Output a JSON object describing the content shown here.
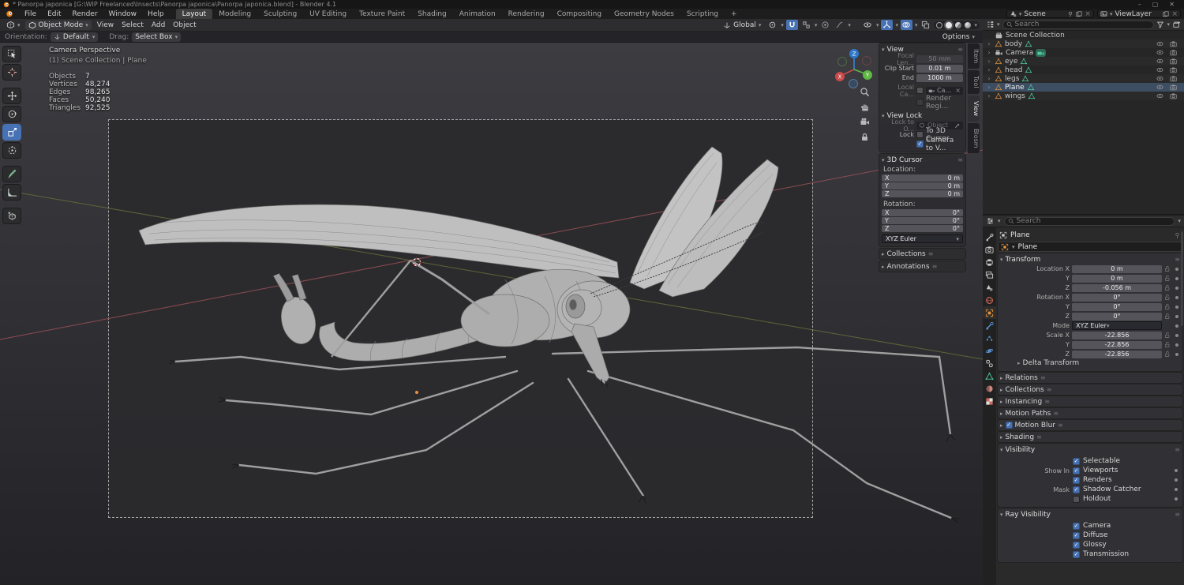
{
  "titlebar": {
    "title": "* Panorpa japonica [G:\\WIP Freelanced\\Insects\\Panorpa japonica\\Panorpa japonica.blend] - Blender 4.1",
    "minimize": "–",
    "maximize": "▢",
    "close": "✕"
  },
  "topbar": {
    "menus": [
      "File",
      "Edit",
      "Render",
      "Window",
      "Help"
    ],
    "workspaces": [
      "Layout",
      "Modeling",
      "Sculpting",
      "UV Editing",
      "Texture Paint",
      "Shading",
      "Animation",
      "Rendering",
      "Compositing",
      "Geometry Nodes",
      "Scripting"
    ],
    "active_workspace": "Layout",
    "new_workspace_label": "+",
    "scene_selector": {
      "value": "Scene"
    },
    "viewlayer_selector": {
      "value": "ViewLayer"
    }
  },
  "viewport_header": {
    "mode": "Object Mode",
    "menus": [
      "View",
      "Select",
      "Add",
      "Object"
    ],
    "orientation": "Global"
  },
  "tool_settings": {
    "orientation_label": "Orientation:",
    "orientation_value": "Default",
    "drag_label": "Drag:",
    "drag_value": "Select Box",
    "options_label": "Options"
  },
  "toolbar": {
    "tools": [
      "tweak-select",
      "cursor",
      "move",
      "rotate",
      "scale",
      "transform",
      "annotate",
      "measure",
      "add-cube"
    ],
    "active_tool": "scale"
  },
  "viewport_overlay": {
    "view_label": "Camera Perspective",
    "context_label": "(1) Scene Collection | Plane",
    "stats": [
      {
        "label": "Objects",
        "value": "7"
      },
      {
        "label": "Vertices",
        "value": "48,274"
      },
      {
        "label": "Edges",
        "value": "98,265"
      },
      {
        "label": "Faces",
        "value": "50,240"
      },
      {
        "label": "Triangles",
        "value": "92,525"
      }
    ],
    "gizmo_axes": {
      "x": "X",
      "y": "Y",
      "z": "Z"
    }
  },
  "sidebar": {
    "tabs": [
      "Item",
      "Tool",
      "View",
      "Blosm"
    ],
    "active_tab": "View",
    "view_panel": {
      "title": "View",
      "focal_label": "Focal Len...",
      "focal_value": "50 mm",
      "clip_start_label": "Clip Start",
      "clip_start_value": "0.01 m",
      "clip_end_label": "End",
      "clip_end_value": "1000 m",
      "local_camera_label": "Local Ca...",
      "local_camera_value": "Ca...",
      "render_region_label": "Render Regi..."
    },
    "view_lock_panel": {
      "title": "View Lock",
      "lock_object_label": "Lock to O...",
      "lock_object_placeholder": "Object",
      "lock_label": "Lock",
      "to_3d_cursor_label": "To 3D Cursor",
      "camera_to_view_label": "Camera to V..."
    },
    "cursor_panel": {
      "title": "3D Cursor",
      "location_label": "Location:",
      "location": [
        {
          "axis": "X",
          "value": "0 m"
        },
        {
          "axis": "Y",
          "value": "0 m"
        },
        {
          "axis": "Z",
          "value": "0 m"
        }
      ],
      "rotation_label": "Rotation:",
      "rotation": [
        {
          "axis": "X",
          "value": "0°"
        },
        {
          "axis": "Y",
          "value": "0°"
        },
        {
          "axis": "Z",
          "value": "0°"
        }
      ],
      "rotation_mode": "XYZ Euler"
    },
    "collapsed_panels": [
      "Collections",
      "Annotations"
    ]
  },
  "outliner": {
    "search_placeholder": "Search",
    "root": "Scene Collection",
    "items": [
      {
        "name": "body",
        "type": "mesh",
        "selected": false
      },
      {
        "name": "Camera",
        "type": "camera",
        "selected": false
      },
      {
        "name": "eye",
        "type": "mesh",
        "selected": false
      },
      {
        "name": "head",
        "type": "mesh",
        "selected": false
      },
      {
        "name": "legs",
        "type": "mesh",
        "selected": false
      },
      {
        "name": "Plane",
        "type": "mesh",
        "selected": true
      },
      {
        "name": "wings",
        "type": "mesh",
        "selected": false
      }
    ]
  },
  "properties": {
    "search_placeholder": "Search",
    "tabs": [
      "tool",
      "render",
      "output",
      "view-layer",
      "scene",
      "world",
      "object",
      "modifiers",
      "particles",
      "physics",
      "constraints",
      "data",
      "material",
      "texture"
    ],
    "active_tab": "object",
    "breadcrumb": "Plane",
    "name_field": "Plane",
    "transform": {
      "title": "Transform",
      "rows": [
        {
          "label": "Location X",
          "value": "0 m",
          "widget": "field"
        },
        {
          "label": "Y",
          "value": "0 m",
          "widget": "field"
        },
        {
          "label": "Z",
          "value": "-0.056 m",
          "widget": "field"
        },
        {
          "label": "Rotation X",
          "value": "0°",
          "widget": "field"
        },
        {
          "label": "Y",
          "value": "0°",
          "widget": "field"
        },
        {
          "label": "Z",
          "value": "0°",
          "widget": "field"
        },
        {
          "label": "Mode",
          "value": "XYZ Euler",
          "widget": "dropdown"
        },
        {
          "label": "Scale X",
          "value": "-22.856",
          "widget": "field"
        },
        {
          "label": "Y",
          "value": "-22.856",
          "widget": "field"
        },
        {
          "label": "Z",
          "value": "-22.856",
          "widget": "field"
        }
      ],
      "sub_collapsed": "Delta Transform"
    },
    "collapsed_panels": [
      {
        "label": "Relations",
        "checkbox": false,
        "checked": false
      },
      {
        "label": "Collections",
        "checkbox": false,
        "checked": false
      },
      {
        "label": "Instancing",
        "checkbox": false,
        "checked": false
      },
      {
        "label": "Motion Paths",
        "checkbox": false,
        "checked": false
      },
      {
        "label": "Motion Blur",
        "checkbox": true,
        "checked": true
      },
      {
        "label": "Shading",
        "checkbox": false,
        "checked": false
      }
    ],
    "visibility": {
      "title": "Visibility",
      "rows": [
        {
          "prefix": "",
          "label": "Selectable",
          "checked": true,
          "dot": false
        },
        {
          "prefix": "Show In",
          "label": "Viewports",
          "checked": true,
          "dot": true
        },
        {
          "prefix": "",
          "label": "Renders",
          "checked": true,
          "dot": true
        },
        {
          "prefix": "Mask",
          "label": "Shadow Catcher",
          "checked": true,
          "dot": true
        },
        {
          "prefix": "",
          "label": "Holdout",
          "checked": false,
          "dot": true
        }
      ]
    },
    "ray_visibility": {
      "title": "Ray Visibility",
      "rows": [
        {
          "label": "Camera",
          "checked": true
        },
        {
          "label": "Diffuse",
          "checked": true
        },
        {
          "label": "Glossy",
          "checked": true
        },
        {
          "label": "Transmission",
          "checked": true
        }
      ]
    }
  },
  "colors": {
    "accent": "#4772b3",
    "object_orange": "#e8923c",
    "mesh_data_green": "#55c9a6",
    "axis_x_red": "#9e5257",
    "axis_y_olive": "#6a6d39"
  }
}
